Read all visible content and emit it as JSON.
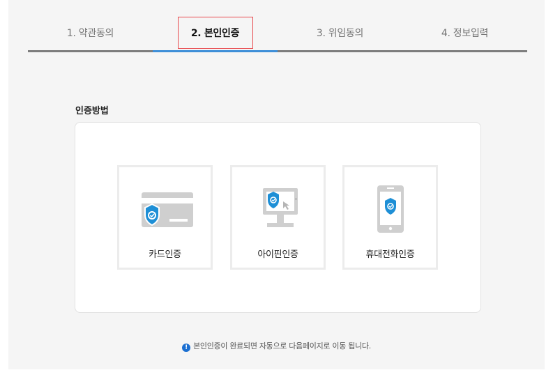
{
  "steps": [
    {
      "label": "1. 약관동의",
      "active": false
    },
    {
      "label": "2. 본인인증",
      "active": true
    },
    {
      "label": "3. 위임동의",
      "active": false
    },
    {
      "label": "4. 정보입력",
      "active": false
    }
  ],
  "section_title": "인증방법",
  "options": [
    {
      "label": "카드인증",
      "icon": "credit-card-shield-icon"
    },
    {
      "label": "아이핀인증",
      "icon": "monitor-shield-icon"
    },
    {
      "label": "휴대전화인증",
      "icon": "phone-shield-icon"
    }
  ],
  "notice": {
    "icon": "info-icon",
    "text": "본인인증이 완료되면 자동으로 다음페이지로 이동 됩니다."
  },
  "colors": {
    "accent": "#3e8fd8",
    "highlight": "#e8484c",
    "shield": "#1e8fd6",
    "info": "#1b6fd1"
  }
}
